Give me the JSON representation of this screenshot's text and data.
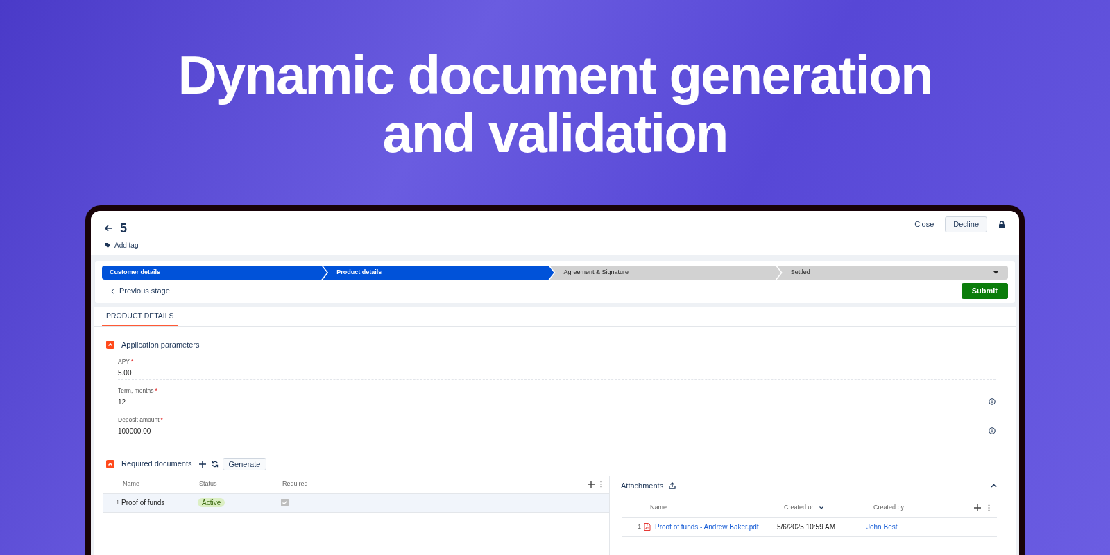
{
  "headline": [
    "Dynamic document generation",
    "and validation"
  ],
  "record": {
    "title": "5",
    "add_tag": "Add tag",
    "actions": {
      "close": "Close",
      "decline": "Decline"
    }
  },
  "stages": [
    {
      "label": "Customer details",
      "completed": true,
      "dropdown": false
    },
    {
      "label": "Product details",
      "completed": true,
      "dropdown": false
    },
    {
      "label": "Agreement & Signature",
      "completed": false,
      "dropdown": false
    },
    {
      "label": "Settled",
      "completed": false,
      "dropdown": true
    }
  ],
  "previous_stage": "Previous stage",
  "submit": "Submit",
  "tabs": [
    {
      "label": "PRODUCT DETAILS",
      "selected": true
    }
  ],
  "application_parameters": {
    "title": "Application parameters",
    "expanded": true,
    "fields": [
      {
        "label": "APY",
        "required_mark": "*",
        "value": "5.00",
        "info": false
      },
      {
        "label": "Term, months",
        "required_mark": "*",
        "value": "12",
        "info": true
      },
      {
        "label": "Deposit amount",
        "required_mark": "*",
        "value": "100000.00",
        "info": true
      }
    ]
  },
  "required_documents": {
    "title": "Required documents",
    "expanded": true,
    "generate": "Generate",
    "columns": [
      "Name",
      "Status",
      "Required"
    ],
    "rows": [
      {
        "index": "1",
        "name": "Proof of funds",
        "status": "Active",
        "required": true,
        "selected": true
      }
    ]
  },
  "attachments": {
    "title": "Attachments",
    "columns": [
      "Name",
      "Created on",
      "Created by"
    ],
    "rows": [
      {
        "index": "1",
        "name": "Proof of funds - Andrew Baker.pdf",
        "created_on": "5/6/2025 10:59 AM",
        "created_by": "John Best"
      }
    ]
  }
}
